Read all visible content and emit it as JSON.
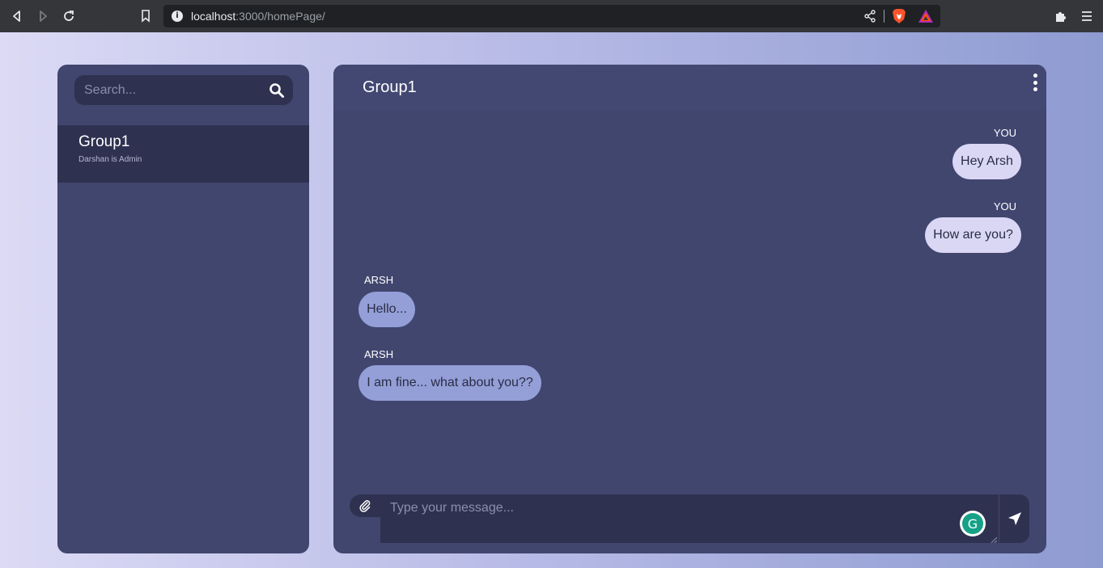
{
  "browser": {
    "url_host": "localhost",
    "url_path": ":3000/homePage/",
    "info_icon": "i"
  },
  "sidebar": {
    "search": {
      "placeholder": "Search..."
    },
    "groups": [
      {
        "name": "Group1",
        "subtitle": "Darshan is Admin"
      }
    ]
  },
  "chat": {
    "title": "Group1",
    "messages": [
      {
        "sender": "YOU",
        "text": "Hey Arsh",
        "mine": true
      },
      {
        "sender": "YOU",
        "text": "How are you?",
        "mine": true
      },
      {
        "sender": "ARSH",
        "text": "Hello...",
        "mine": false
      },
      {
        "sender": "ARSH",
        "text": "I am fine... what about you??",
        "mine": false
      }
    ],
    "composer": {
      "placeholder": "Type your message...",
      "grammarly_letter": "G"
    }
  },
  "colors": {
    "panel": "#41466f",
    "panel_dark": "#2f3150",
    "bubble_mine": "#dad7f5",
    "bubble_theirs": "#949fd8"
  }
}
